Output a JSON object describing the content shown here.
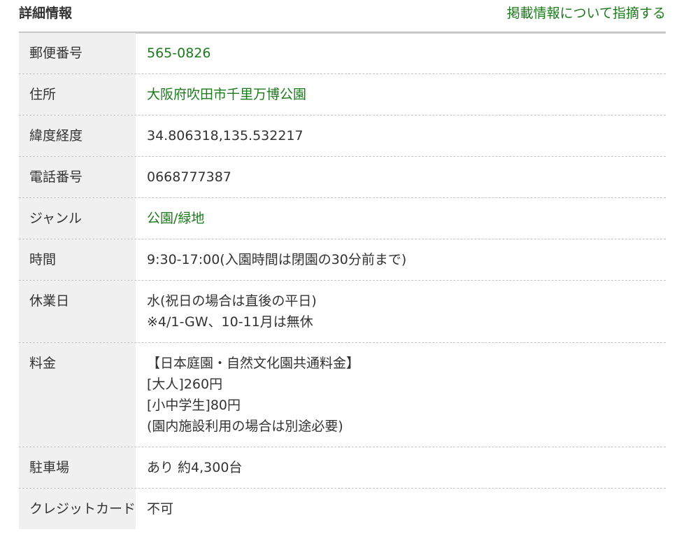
{
  "header": {
    "title": "詳細情報",
    "report_link": "掲載情報について指摘する"
  },
  "rows": [
    {
      "label": "郵便番号",
      "value": "565-0826",
      "link": true
    },
    {
      "label": "住所",
      "value": "大阪府吹田市千里万博公園",
      "link": true
    },
    {
      "label": "緯度経度",
      "value": "34.806318,135.532217",
      "link": false
    },
    {
      "label": "電話番号",
      "value": "0668777387",
      "link": false
    },
    {
      "label": "ジャンル",
      "value": "公園/緑地",
      "link": true
    },
    {
      "label": "時間",
      "value": "9:30-17:00(入園時間は閉園の30分前まで)",
      "link": false
    },
    {
      "label": "休業日",
      "lines": [
        "水(祝日の場合は直後の平日)",
        "※4/1-GW、10-11月は無休"
      ]
    },
    {
      "label": "料金",
      "lines": [
        "【日本庭園・自然文化園共通料金】",
        "[大人]260円",
        "[小中学生]80円",
        "(園内施設利用の場合は別途必要)"
      ]
    },
    {
      "label": "駐車場",
      "value": "あり 約4,300台",
      "link": false
    },
    {
      "label": "クレジットカード",
      "value": "不可",
      "link": false
    }
  ],
  "colors": {
    "link": "#1c7a1c",
    "label_bg": "#f0f0f0",
    "header_rule": "#c8c8c8"
  }
}
